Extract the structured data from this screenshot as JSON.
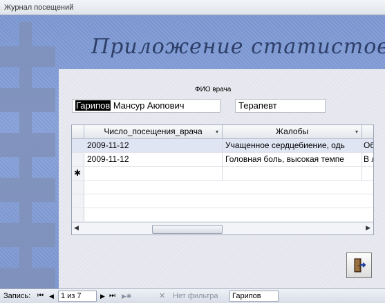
{
  "window": {
    "title": "Журнал посещений"
  },
  "app_title": "Приложение статистов",
  "doctor": {
    "fio_label": "ФИО врача",
    "fio_selected": "Гарипов",
    "fio_rest": " Мансур Аюпович",
    "specialty": "Терапевт"
  },
  "grid": {
    "columns": [
      "Число_посещения_врача",
      "Жалобы"
    ],
    "rows": [
      {
        "date": "2009-11-12",
        "complaint": "Учащенное сердцебиение, одь",
        "extra": "Об"
      },
      {
        "date": "2009-11-12",
        "complaint": "Головная боль, высокая темпе",
        "extra": "В л"
      }
    ],
    "new_row_marker": "✱"
  },
  "navigator": {
    "record_label": "Запись:",
    "position": "1 из 7",
    "filter_label": "Нет фильтра",
    "search_value": "Гарипов"
  },
  "icons": {
    "first": "⏮",
    "prev": "◀",
    "next": "▶",
    "last": "⏭",
    "new": "▶✱",
    "exit": "exit-door-icon"
  }
}
